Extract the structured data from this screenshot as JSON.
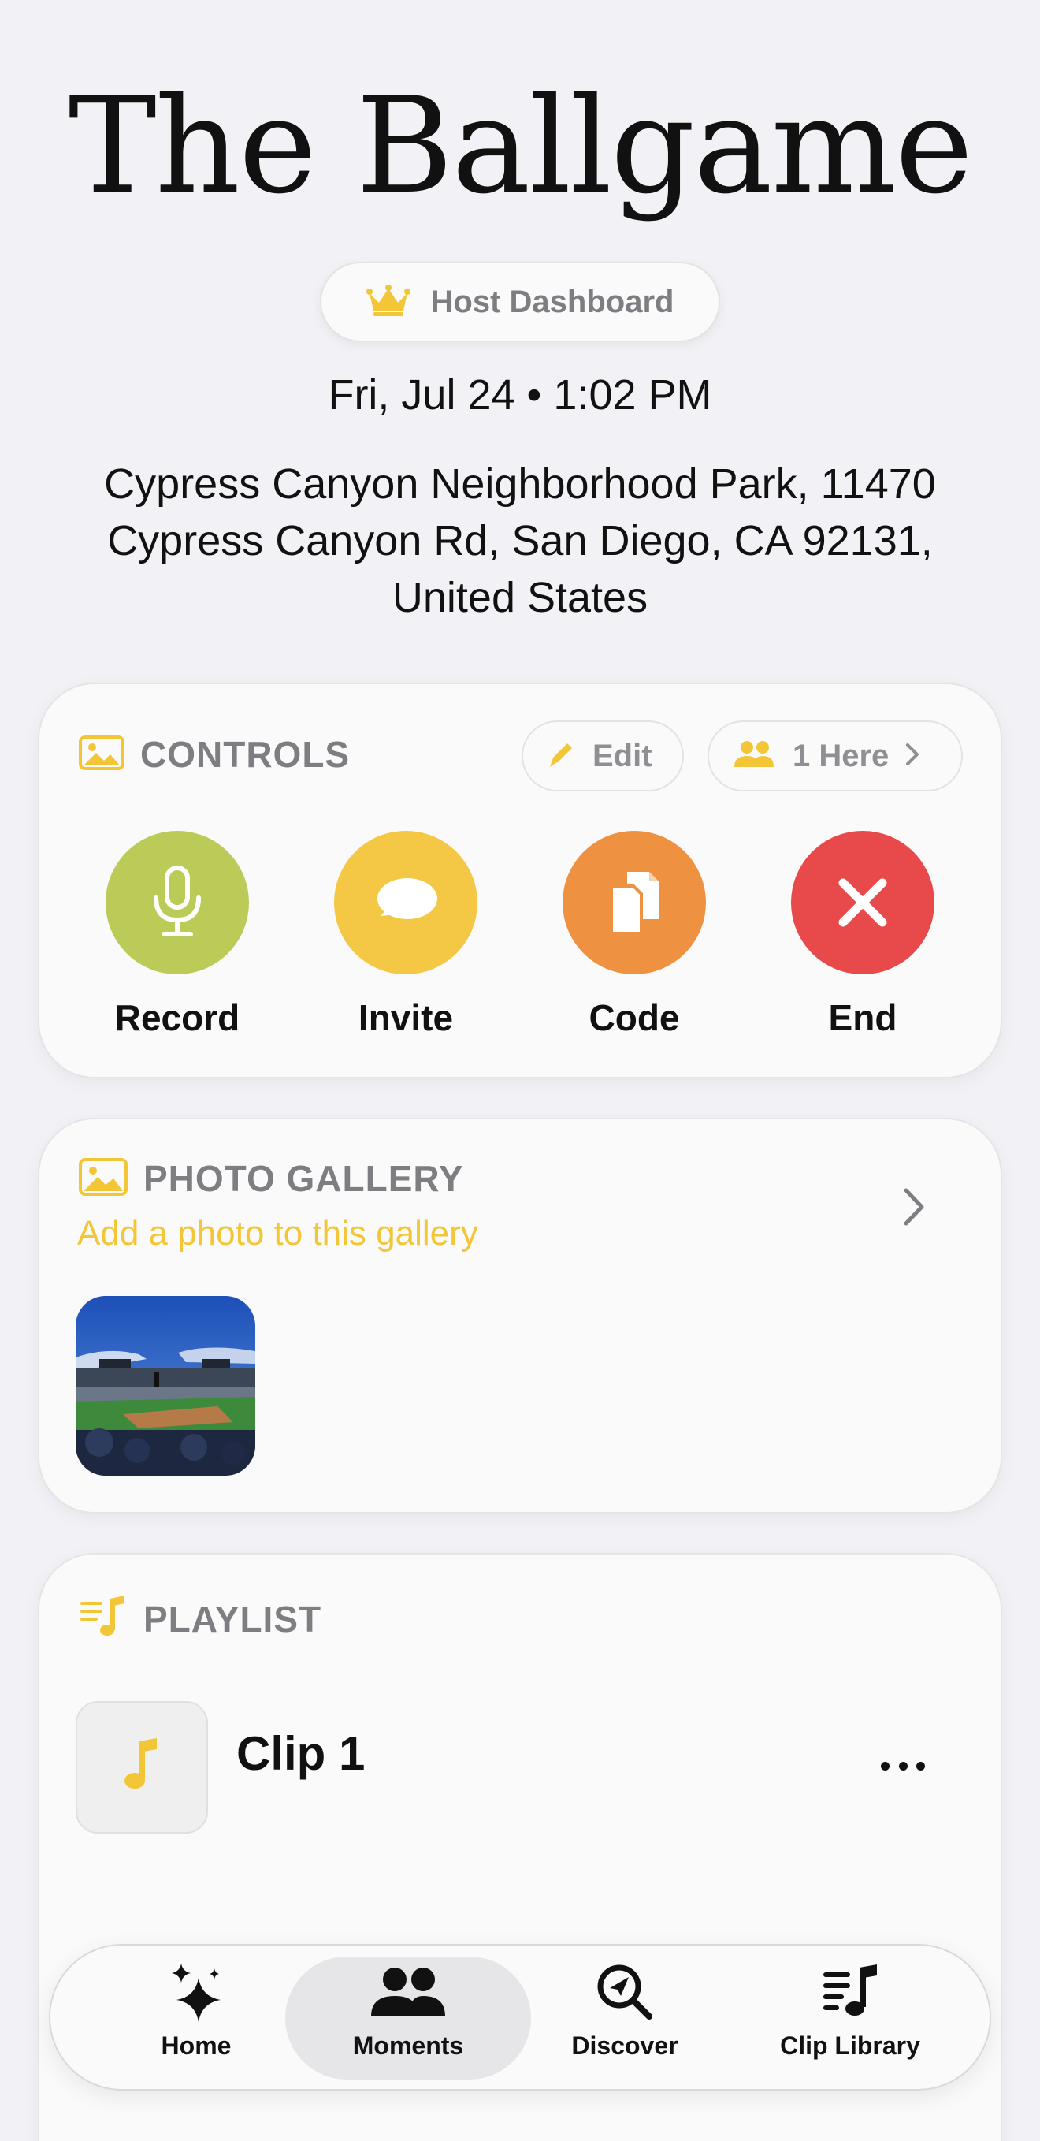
{
  "header": {
    "title": "The Ballgame",
    "host_label": "Host Dashboard",
    "datetime": "Fri, Jul 24 • 1:02 PM",
    "location": "Cypress Canyon Neighborhood Park, 11470 Cypress Canyon Rd, San Diego, CA 92131, United States"
  },
  "controls": {
    "title": "CONTROLS",
    "edit_label": "Edit",
    "here_label": "1 Here",
    "actions": [
      {
        "label": "Record",
        "icon": "microphone-icon",
        "color": "#bccb57"
      },
      {
        "label": "Invite",
        "icon": "chat-bubble-icon",
        "color": "#f4c744"
      },
      {
        "label": "Code",
        "icon": "copy-document-icon",
        "color": "#ee9140"
      },
      {
        "label": "End",
        "icon": "close-x-icon",
        "color": "#e8494a"
      }
    ]
  },
  "gallery": {
    "title": "PHOTO GALLERY",
    "subtitle": "Add a photo to this gallery"
  },
  "playlist": {
    "title": "PLAYLIST",
    "items": [
      {
        "title": "Clip 1"
      }
    ]
  },
  "tabbar": {
    "tabs": [
      {
        "label": "Home",
        "icon": "sparkles-icon"
      },
      {
        "label": "Moments",
        "icon": "people-icon",
        "active": true
      },
      {
        "label": "Discover",
        "icon": "discover-search-icon"
      },
      {
        "label": "Clip Library",
        "icon": "music-list-icon"
      }
    ]
  },
  "colors": {
    "accent_yellow": "#f3c638",
    "background": "#f2f2f6",
    "secondary_text": "#7d7d82"
  }
}
